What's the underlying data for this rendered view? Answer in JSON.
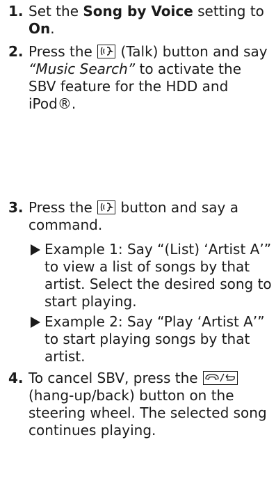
{
  "steps": [
    {
      "num": "1.",
      "t1": "Set the ",
      "b1": "Song by Voice",
      "t2": " setting to ",
      "b2": "On",
      "t3": "."
    },
    {
      "num": "2.",
      "t1": "Press the ",
      "t2": " (Talk) button and say ",
      "i1": "“Music Search”",
      "t3": " to activate the SBV feature for the HDD and iPod®."
    },
    {
      "num": "3.",
      "t1": "Press the ",
      "t2": " button and say a command."
    },
    {
      "num": "4.",
      "t1": "To cancel SBV, press the ",
      "t2": " (hang-up/back) button on the steering wheel. The selected song continues playing."
    }
  ],
  "examples": [
    "Example 1: Say “(List) ‘Artist A’” to view a list of songs by that artist. Select the desired song to start playing.",
    "Example 2: Say “Play ‘Artist A’” to start playing songs by that artist."
  ],
  "icons": [
    "talk-button-icon",
    "hang-up-back-button-icon",
    "triangle-bullet-icon"
  ]
}
